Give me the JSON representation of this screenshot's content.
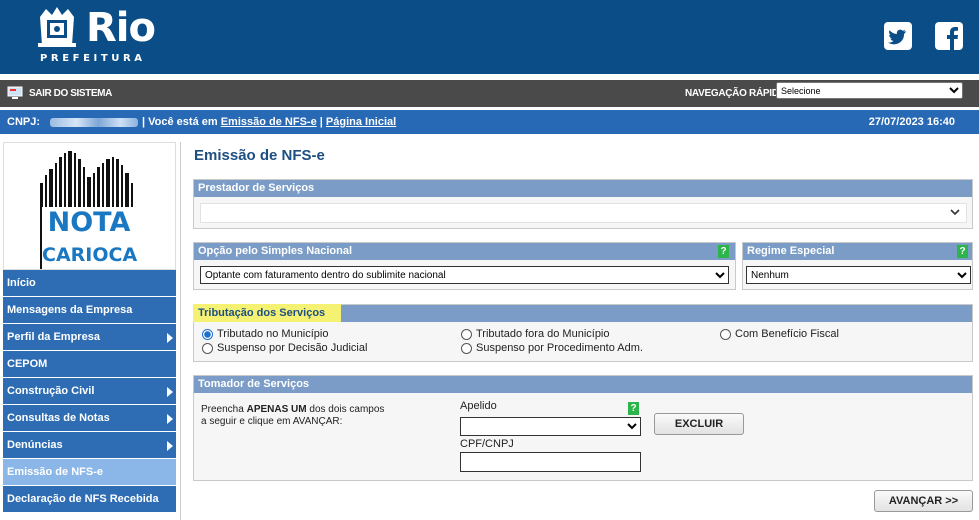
{
  "header": {
    "brand_title": "Rio",
    "brand_subtitle": "PREFEITURA",
    "icons": [
      "crest-icon",
      "twitter-icon",
      "facebook-icon"
    ]
  },
  "topbar": {
    "exit_label": "SAIR DO SISTEMA",
    "quick_nav_label": "NAVEGAÇÃO RÁPIDA",
    "quick_nav_selected": "Selecione"
  },
  "infobar": {
    "cnpj_label": "CNPJ:",
    "location_prefix": "| Você está em",
    "breadcrumb": [
      "Emissão de NFS-e",
      "Página Inicial"
    ],
    "separator": "|",
    "datetime": "27/07/2023 16:40"
  },
  "sidebar": {
    "logo_line1": "NOTA",
    "logo_line2": "CARIOCA",
    "items": [
      {
        "label": "Início",
        "arrow": false
      },
      {
        "label": "Mensagens da Empresa",
        "arrow": false
      },
      {
        "label": "Perfil da Empresa",
        "arrow": true
      },
      {
        "label": "CEPOM",
        "arrow": false
      },
      {
        "label": "Construção Civil",
        "arrow": true
      },
      {
        "label": "Consultas de Notas",
        "arrow": true
      },
      {
        "label": "Denúncias",
        "arrow": true
      },
      {
        "label": "Emissão de NFS-e",
        "arrow": false,
        "active": true
      },
      {
        "label": "Declaração de NFS Recebida",
        "arrow": false
      }
    ]
  },
  "main": {
    "title": "Emissão de NFS-e",
    "prestador": {
      "heading": "Prestador de Serviços",
      "value": ""
    },
    "simples": {
      "heading": "Opção pelo Simples Nacional",
      "value": "Optante com faturamento dentro do sublimite nacional",
      "help": "?"
    },
    "regime": {
      "heading": "Regime Especial",
      "value": "Nenhum",
      "help": "?"
    },
    "tributacao": {
      "heading": "Tributação dos Serviços",
      "options": [
        {
          "label": "Tributado no Município",
          "checked": true
        },
        {
          "label": "Tributado fora do Município",
          "checked": false
        },
        {
          "label": "Com Benefício Fiscal",
          "checked": false
        },
        {
          "label": "Suspenso por Decisão Judicial",
          "checked": false
        },
        {
          "label": "Suspenso por Procedimento Adm.",
          "checked": false
        }
      ]
    },
    "tomador": {
      "heading": "Tomador de Serviços",
      "instruction_pre": "Preencha ",
      "instruction_bold": "APENAS UM",
      "instruction_post": " dos dois campos",
      "instruction_line2": "a seguir e clique em AVANÇAR:",
      "apelido_label": "Apelido",
      "apelido_value": "",
      "help": "?",
      "cpf_label": "CPF/CNPJ",
      "cpf_value": "",
      "excluir_label": "EXCLUIR"
    },
    "avancar_label": "AVANÇAR >>"
  },
  "colors": {
    "header_blue": "#0b4d86",
    "infobar_blue": "#2869b5",
    "menu_blue": "#2e6db4",
    "menu_active": "#8ab7e8",
    "panel_head": "#7a9cc6",
    "highlight_yellow": "#f5f173",
    "help_green": "#2db44a"
  }
}
